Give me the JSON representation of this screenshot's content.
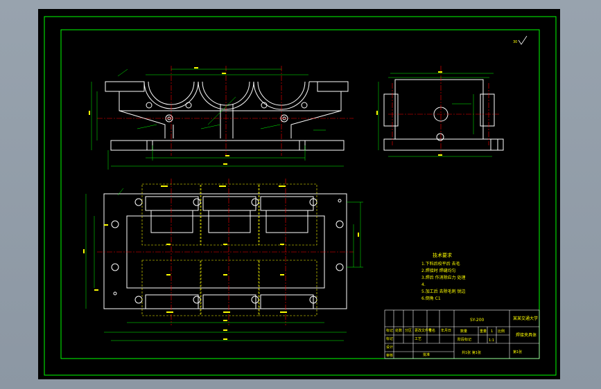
{
  "drawing": {
    "colors": {
      "background": "#000000",
      "border": "#00ff00",
      "outline": "#ffffff",
      "dimension": "#00ff00",
      "centerline": "#ff0000",
      "hidden": "#ffff00",
      "text": "#ffff00",
      "sheet_frame": "#2b2b2b"
    },
    "roughness_mark": "30",
    "tech_requirements": {
      "title": "技术要求",
      "lines": [
        "1.下料后校平后   去毛",
        "2.焊接时 焊缝均匀",
        "3.焊后   作消除应力  处理",
        "4.   ",
        "5.加工后 去除毛刺 锐边",
        "6.倒角 C1"
      ]
    },
    "title_block": {
      "drawing_no": "SY-200",
      "org": "某某交通大学",
      "part_name": "焊接夹具体",
      "material_label": "数量",
      "qty": "1",
      "scale": "1:1",
      "sheet": "共1张 第1张",
      "sign_text": "第1张",
      "row_labels": [
        "标记",
        "设计",
        "审核",
        "工艺"
      ],
      "header_cells": [
        "标记",
        "处数",
        "分区",
        "更改文件号",
        "签名",
        "年月日"
      ],
      "sub_cells": [
        "阶段标记",
        "重量",
        "比例"
      ],
      "approve_label": "批准"
    }
  }
}
